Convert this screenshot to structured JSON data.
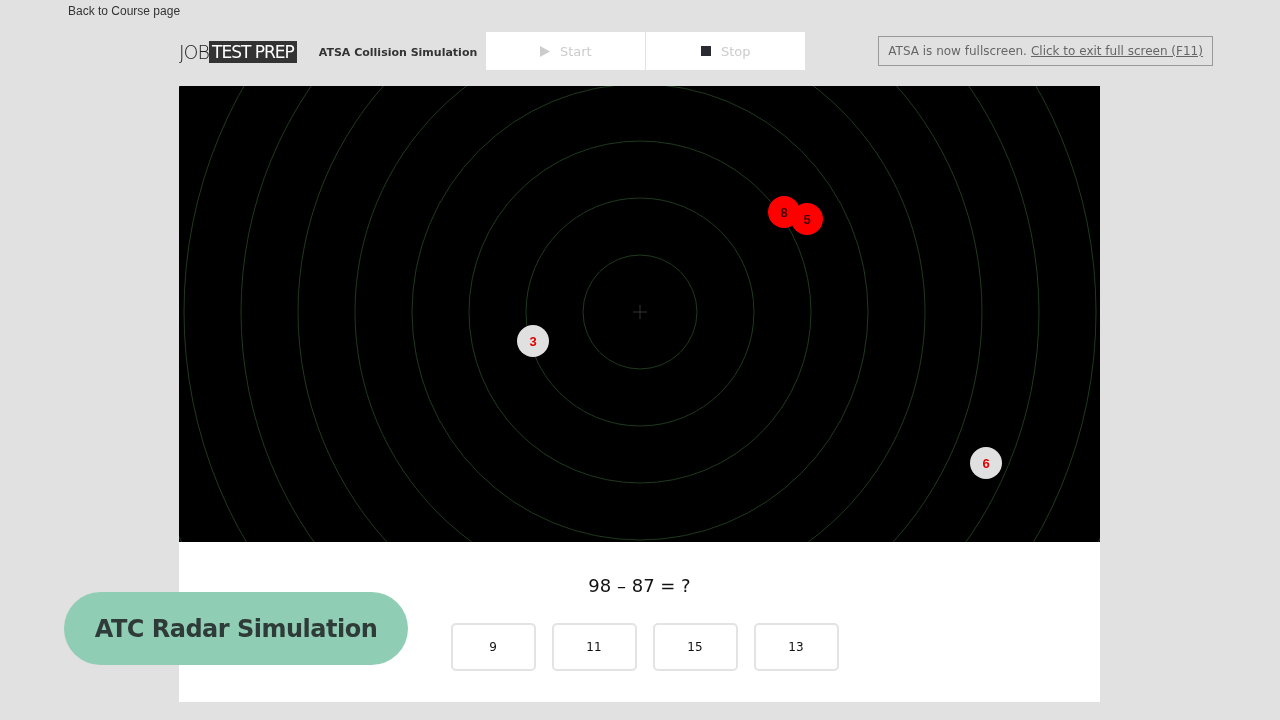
{
  "back_link": "Back to Course page",
  "logo": {
    "part_1": "JOB",
    "part_2": "TEST PREP"
  },
  "title": "ATSA Collision Simulation",
  "buttons": [
    {
      "kind": "start",
      "label": "Start",
      "disabled": true
    },
    {
      "kind": "stop",
      "label": "Stop",
      "disabled": true
    }
  ],
  "notice": {
    "text": "ATSA is now fullscreen.",
    "link": "Click to exit full screen (F11)"
  },
  "radar": {
    "aircraft": [
      {
        "label": "3",
        "color": "#e0e0e0"
      },
      {
        "label": "8",
        "color": "#ff0000"
      },
      {
        "label": "5",
        "color": "#ff0000"
      },
      {
        "label": "6",
        "color": "#e0e0e0"
      }
    ]
  },
  "question": "98 – 87 = ?",
  "answers": [
    {
      "label": "9"
    },
    {
      "label": "11"
    },
    {
      "label": "15"
    },
    {
      "label": "13"
    }
  ],
  "caption": "ATC Radar Simulation"
}
